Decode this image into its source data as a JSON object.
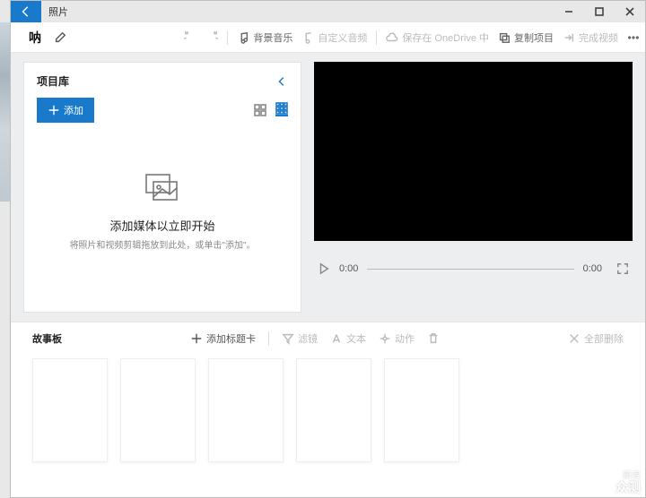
{
  "app": {
    "title": "照片"
  },
  "project": {
    "name": "呐"
  },
  "toolbar": {
    "bgm": "背景音乐",
    "custom_audio": "自定义音频",
    "save_onedrive": "保存在 OneDrive 中",
    "copy_project": "复制项目",
    "finish_video": "完成视频"
  },
  "library": {
    "title": "项目库",
    "add": "添加",
    "empty_title": "添加媒体以立即开始",
    "empty_sub": "将照片和视频剪辑拖放到此处，或单击\"添加\"。"
  },
  "player": {
    "current": "0:00",
    "total": "0:00"
  },
  "storyboard": {
    "title": "故事板",
    "add_title_card": "添加标题卡",
    "filter": "滤镜",
    "text": "文本",
    "motion": "动作",
    "delete_all": "全部删除"
  },
  "watermark": {
    "line1": "新浪",
    "line2": "众测"
  }
}
